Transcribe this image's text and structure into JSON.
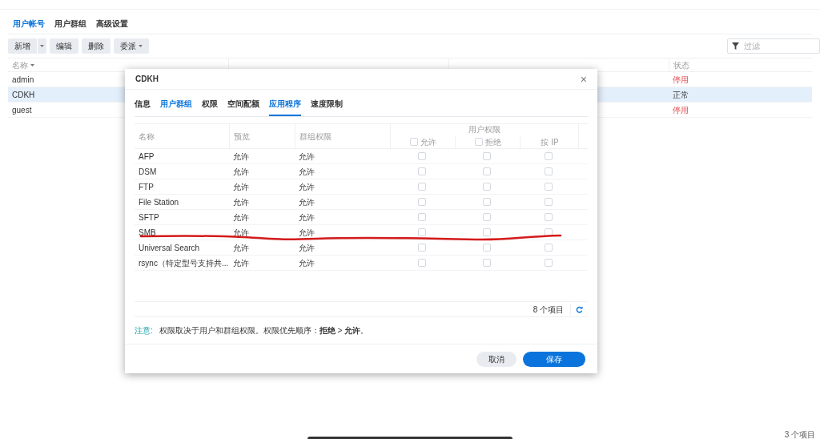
{
  "tabs": [
    {
      "label": "用户帐号",
      "selected": true
    },
    {
      "label": "用户群组",
      "selected": false
    },
    {
      "label": "高级设置",
      "selected": false
    }
  ],
  "toolbar": {
    "buttons": [
      {
        "label": "新增",
        "kind": "split"
      },
      {
        "label": "编辑",
        "kind": "plain"
      },
      {
        "label": "删除",
        "kind": "plain"
      },
      {
        "label": "委派",
        "kind": "menu"
      }
    ],
    "filter": {
      "placeholder": "过滤"
    }
  },
  "table": {
    "columns": [
      {
        "label": "名称",
        "sorted": true
      },
      {
        "label": "状态",
        "sorted": false
      }
    ],
    "rows": [
      {
        "name": "admin",
        "selected": false,
        "status": {
          "text": "停用",
          "kind": "disabled"
        }
      },
      {
        "name": "CDKH",
        "selected": true,
        "status": {
          "text": "正常",
          "kind": "normal"
        }
      },
      {
        "name": "guest",
        "selected": false,
        "status": {
          "text": "停用",
          "kind": "disabled"
        }
      }
    ]
  },
  "footer": {
    "count": "3 个项目"
  },
  "dialog": {
    "title": "CDKH",
    "close": "×",
    "tabs": [
      {
        "label": "信息",
        "selected": false,
        "hover": false
      },
      {
        "label": "用户群组",
        "selected": false,
        "hover": true
      },
      {
        "label": "权限",
        "selected": false,
        "hover": false
      },
      {
        "label": "空间配额",
        "selected": false,
        "hover": false
      },
      {
        "label": "应用程序",
        "selected": true,
        "hover": false
      },
      {
        "label": "速度限制",
        "selected": false,
        "hover": false
      }
    ],
    "columns": [
      "名称",
      "预览",
      "群组权限"
    ],
    "user_permissions": {
      "label": "用户权限",
      "columns": [
        {
          "label": "允许",
          "kind": "checkbox",
          "checked": false
        },
        {
          "label": "拒绝",
          "kind": "checkbox",
          "checked": false
        },
        {
          "label": "按 IP",
          "kind": "plain"
        }
      ]
    },
    "rows": [
      {
        "name": "AFP",
        "preview": "允许",
        "group": "允许",
        "allow": false,
        "deny": false,
        "by_ip": false
      },
      {
        "name": "DSM",
        "preview": "允许",
        "group": "允许",
        "allow": false,
        "deny": false,
        "by_ip": false
      },
      {
        "name": "FTP",
        "preview": "允许",
        "group": "允许",
        "allow": false,
        "deny": false,
        "by_ip": false
      },
      {
        "name": "File Station",
        "preview": "允许",
        "group": "允许",
        "allow": false,
        "deny": false,
        "by_ip": false
      },
      {
        "name": "SFTP",
        "preview": "允许",
        "group": "允许",
        "allow": false,
        "deny": false,
        "by_ip": false
      },
      {
        "name": "SMB",
        "preview": "允许",
        "group": "允许",
        "allow": false,
        "deny": false,
        "by_ip": false
      },
      {
        "name": "Universal Search",
        "preview": "允许",
        "group": "允许",
        "allow": false,
        "deny": false,
        "by_ip": false
      },
      {
        "name": "rsync（特定型号支持共...",
        "preview": "允许",
        "group": "允许",
        "allow": false,
        "deny": false,
        "by_ip": false
      }
    ],
    "count": "8 个项目",
    "note": {
      "label": "注意:",
      "text": "权限取决于用户和群组权限。权限优先顺序：**拒绝** > **允许**。"
    },
    "buttons": [
      {
        "label": "取消",
        "kind": "secondary"
      },
      {
        "label": "保存",
        "kind": "primary"
      }
    ]
  }
}
